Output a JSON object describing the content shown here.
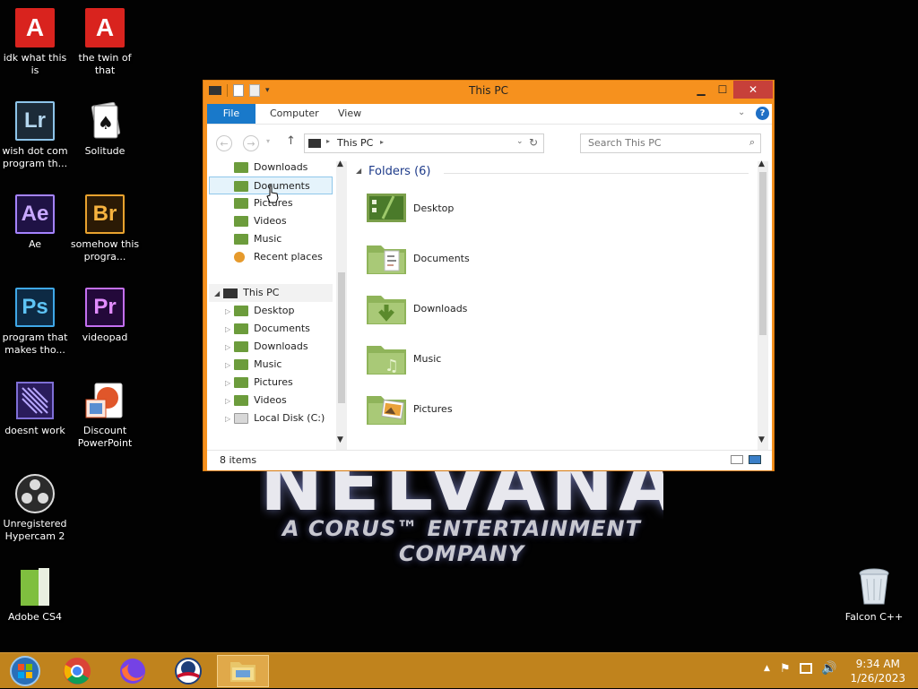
{
  "desktop_icons": [
    {
      "label": "idk what this is",
      "glyph": "A"
    },
    {
      "label": "the twin of that",
      "glyph": "A"
    },
    {
      "label": "wish dot com program th...",
      "glyph": "Lr"
    },
    {
      "label": "Solitude",
      "glyph": "♠"
    },
    {
      "label": "Ae",
      "glyph": "Ae"
    },
    {
      "label": "somehow this progra...",
      "glyph": "Br"
    },
    {
      "label": "program that makes tho...",
      "glyph": "Ps"
    },
    {
      "label": "videopad",
      "glyph": "Pr"
    },
    {
      "label": "doesnt work",
      "glyph": ""
    },
    {
      "label": "Discount PowerPoint",
      "glyph": ""
    },
    {
      "label": "Unregistered Hypercam 2",
      "glyph": ""
    },
    {
      "label": "Adobe CS4",
      "glyph": ""
    },
    {
      "label": "Falcon C++",
      "glyph": ""
    }
  ],
  "wallpaper": {
    "logo": "NELVANA",
    "tagline": "A CORUS™ ENTERTAINMENT COMPANY"
  },
  "window": {
    "title": "This PC",
    "ribbon_tabs": [
      "File",
      "Computer",
      "View"
    ],
    "address": "This PC",
    "search_placeholder": "Search This PC",
    "nav_items": [
      {
        "label": "Downloads"
      },
      {
        "label": "Documents"
      },
      {
        "label": "Pictures"
      },
      {
        "label": "Videos"
      },
      {
        "label": "Music"
      },
      {
        "label": "Recent places"
      },
      {
        "label": "This PC"
      },
      {
        "label": "Desktop"
      },
      {
        "label": "Documents"
      },
      {
        "label": "Downloads"
      },
      {
        "label": "Music"
      },
      {
        "label": "Pictures"
      },
      {
        "label": "Videos"
      },
      {
        "label": "Local Disk (C:)"
      }
    ],
    "group_header": "Folders (6)",
    "folders": [
      "Desktop",
      "Documents",
      "Downloads",
      "Music",
      "Pictures"
    ],
    "status": "8 items"
  },
  "taskbar": {
    "time": "9:34 AM",
    "date": "1/26/2023"
  }
}
